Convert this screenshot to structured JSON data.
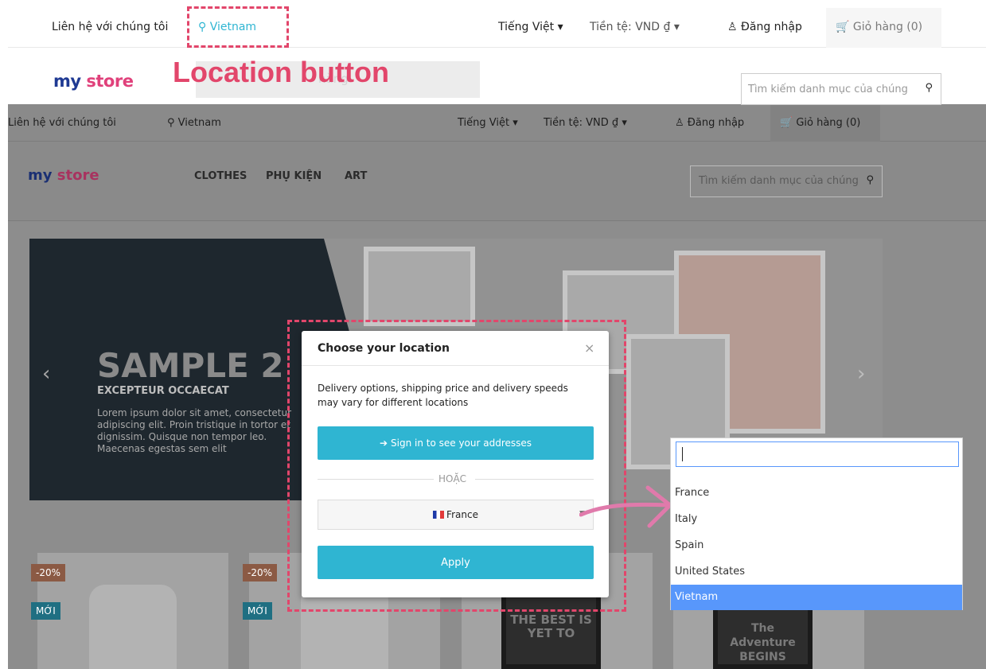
{
  "topbar": {
    "contact": "Liên hệ với chúng tôi",
    "location": "Vietnam",
    "language": "Tiếng Việt",
    "currency": "Tiền tệ: VND ₫",
    "login": "Đăng nhập",
    "cart": "Giỏ hàng (0)"
  },
  "header": {
    "logo_my": "my",
    "logo_store": "store",
    "search_placeholder": "Tìm kiếm danh mục của chúng",
    "menu_hint": "hàng"
  },
  "annotation": {
    "label": "Location button",
    "color": "#e2466b"
  },
  "background_page": {
    "contact": "Liên hệ với chúng tôi",
    "location": "Vietnam",
    "language": "Tiếng Việt",
    "currency": "Tiền tệ: VND ₫",
    "login": "Đăng nhập",
    "cart": "Giỏ hàng (0)",
    "logo_my": "my",
    "logo_store": "store",
    "menu": [
      "CLOTHES",
      "PHỤ KIỆN",
      "ART"
    ],
    "search_placeholder": "Tìm kiếm danh mục của chúng",
    "slide": {
      "title": "SAMPLE 2",
      "subtitle": "EXCEPTEUR OCCAECAT",
      "text": "Lorem ipsum dolor sit amet, consectetur adipiscing elit. Proin tristique in tortor et dignissim. Quisque non tempor leo. Maecenas egestas sem elit"
    },
    "products": [
      {
        "discount": "-20%",
        "new_label": "MỚI"
      },
      {
        "discount": "-20%",
        "new_label": "MỚI"
      }
    ],
    "poster1": "THE BEST IS YET TO",
    "poster2": "The Adventure BEGINS"
  },
  "modal": {
    "title": "Choose your location",
    "close": "×",
    "description": "Delivery options, shipping price and delivery speeds may vary for different locations",
    "signin_button": "Sign in to see your addresses",
    "or_text": "HOẶC",
    "selected_country": "France",
    "apply_button": "Apply"
  },
  "dropdown": {
    "search_value": "",
    "options": [
      "France",
      "Italy",
      "Spain",
      "United States",
      "Vietnam"
    ],
    "selected": "Vietnam"
  },
  "colors": {
    "accent": "#2fb5d2",
    "annotation": "#e2466b",
    "arrow": "#e07aab",
    "dropdown_selected": "#5897fb"
  }
}
